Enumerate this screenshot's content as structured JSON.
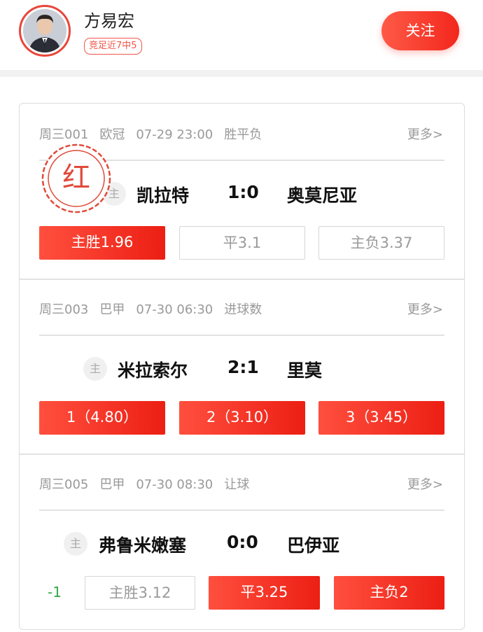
{
  "user": {
    "name": "方易宏",
    "badge": "竞足近7中5",
    "follow_label": "关注"
  },
  "stamp_text": "红",
  "colors": {
    "accent": "#f2271c",
    "handicap": "#33a745",
    "muted": "#999999"
  },
  "matches": [
    {
      "meta": {
        "code": "周三001",
        "league": "欧冠",
        "time": "07-29 23:00",
        "market": "胜平负"
      },
      "more": "更多>",
      "home_tag": "主",
      "home": "凯拉特",
      "score": "1:0",
      "away": "奥莫尼亚",
      "handicap": "",
      "options": [
        {
          "label": "主胜1.96",
          "selected": true
        },
        {
          "label": "平3.1",
          "selected": false
        },
        {
          "label": "主负3.37",
          "selected": false
        }
      ]
    },
    {
      "meta": {
        "code": "周三003",
        "league": "巴甲",
        "time": "07-30 06:30",
        "market": "进球数"
      },
      "more": "更多>",
      "home_tag": "主",
      "home": "米拉索尔",
      "score": "2:1",
      "away": "里莫",
      "handicap": "",
      "options": [
        {
          "label": "1（4.80）",
          "selected": true
        },
        {
          "label": "2（3.10）",
          "selected": true
        },
        {
          "label": "3（3.45）",
          "selected": true
        }
      ]
    },
    {
      "meta": {
        "code": "周三005",
        "league": "巴甲",
        "time": "07-30 08:30",
        "market": "让球"
      },
      "more": "更多>",
      "home_tag": "主",
      "home": "弗鲁米嫩塞",
      "score": "0:0",
      "away": "巴伊亚",
      "handicap": "-1",
      "options": [
        {
          "label": "主胜3.12",
          "selected": false
        },
        {
          "label": "平3.25",
          "selected": true
        },
        {
          "label": "主负2",
          "selected": true
        }
      ]
    }
  ]
}
